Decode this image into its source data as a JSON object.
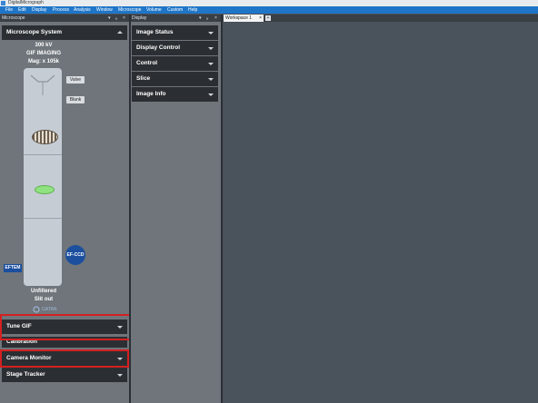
{
  "app": {
    "title": "DigitalMicrograph"
  },
  "menu": [
    "File",
    "Edit",
    "Display",
    "Process",
    "Analysis",
    "Window",
    "Microscope",
    "Volume",
    "Custom",
    "Help"
  ],
  "panels": {
    "microscope": {
      "title": "Microscope",
      "pin": "▾",
      "dock": "ₐ",
      "close": "×"
    },
    "display": {
      "title": "Display",
      "pin": "▾",
      "dock": "ₐ",
      "close": "×"
    }
  },
  "workspace": {
    "tab_label": "Workspace 1",
    "close": "×",
    "add": "+"
  },
  "microscope_system": {
    "header": "Microscope System",
    "voltage": "300 kV",
    "mode": "GIF IMAGING",
    "mag": "Mag: x 105k",
    "valve_label": "Valve",
    "blank_label": "Blank",
    "eftem_label": "EFTEM",
    "efccd_label": "EF-CCD",
    "filter_state": "Unfiltered",
    "slit_state": "Slit out",
    "logo_text": "GATAN"
  },
  "left_sections": [
    "Tune GIF",
    "Calibration",
    "Camera Monitor",
    "Stage Tracker"
  ],
  "display_sections": [
    "Image Status",
    "Display Control",
    "Control",
    "Slice",
    "Image Info"
  ],
  "colors": {
    "accent_blue": "#1f76c8",
    "highlight_red": "#d42020",
    "lens_green": "#8fe27f"
  }
}
